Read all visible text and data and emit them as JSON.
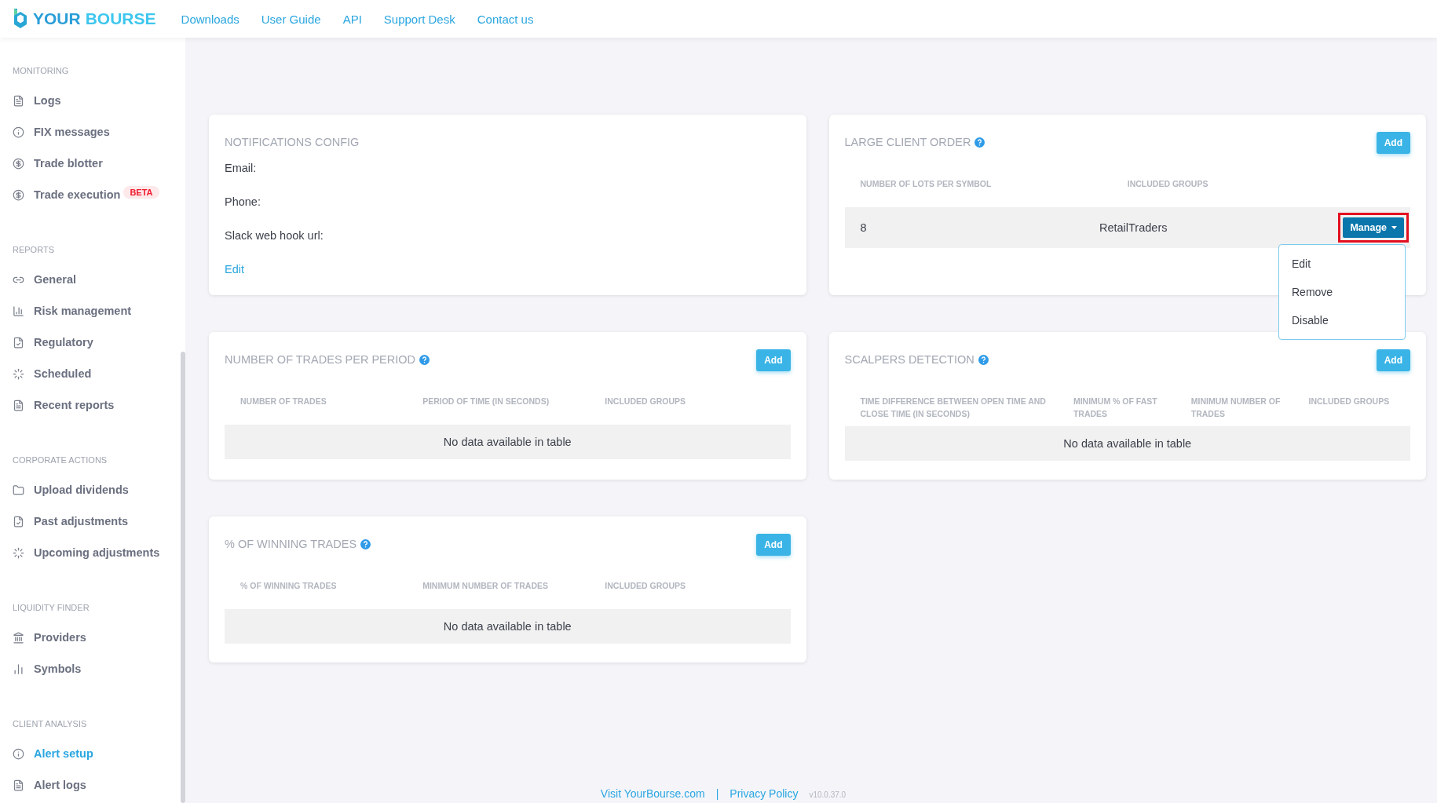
{
  "header": {
    "logo": {
      "word_1": "YOUR",
      "word_2": "BOURSE"
    },
    "nav": [
      "Downloads",
      "User Guide",
      "API",
      "Support Desk",
      "Contact us"
    ]
  },
  "sidebar": {
    "sections": [
      {
        "title": "MONITORING",
        "items": [
          {
            "label": "Logs",
            "selected": false
          },
          {
            "label": "FIX messages",
            "selected": false
          },
          {
            "label": "Trade blotter",
            "selected": false
          },
          {
            "label": "Trade execution",
            "selected": false,
            "badge": "BETA"
          }
        ]
      },
      {
        "title": "REPORTS",
        "items": [
          {
            "label": "General",
            "selected": false
          },
          {
            "label": "Risk management",
            "selected": false
          },
          {
            "label": "Regulatory",
            "selected": false
          },
          {
            "label": "Scheduled",
            "selected": false
          },
          {
            "label": "Recent reports",
            "selected": false
          }
        ]
      },
      {
        "title": "CORPORATE ACTIONS",
        "items": [
          {
            "label": "Upload dividends",
            "selected": false
          },
          {
            "label": "Past adjustments",
            "selected": false
          },
          {
            "label": "Upcoming adjustments",
            "selected": false
          }
        ]
      },
      {
        "title": "LIQUIDITY FINDER",
        "items": [
          {
            "label": "Providers",
            "selected": false
          },
          {
            "label": "Symbols",
            "selected": false
          }
        ]
      },
      {
        "title": "CLIENT ANALYSIS",
        "items": [
          {
            "label": "Alert setup",
            "selected": true
          },
          {
            "label": "Alert logs",
            "selected": false
          }
        ]
      }
    ]
  },
  "cards": [
    {
      "kind": "info",
      "title": "NOTIFICATIONS CONFIG",
      "fields": [
        "Email:",
        "Phone:",
        "Slack web hook url:"
      ],
      "link": "Edit"
    },
    {
      "kind": "table",
      "title": "LARGE CLIENT ORDER",
      "help": true,
      "add_button": "Add",
      "columns": [
        "NUMBER OF LOTS PER SYMBOL",
        "INCLUDED GROUPS"
      ],
      "rows": [
        {
          "cells": [
            "8",
            "RetailTraders"
          ],
          "action": {
            "label": "Manage",
            "highlighted": true,
            "expanded": true,
            "menu": [
              "Edit",
              "Remove",
              "Disable"
            ]
          }
        }
      ]
    },
    {
      "kind": "table",
      "title": "NUMBER OF TRADES PER PERIOD",
      "help": true,
      "add_button": "Add",
      "columns": [
        "NUMBER OF TRADES",
        "PERIOD OF TIME (IN SECONDS)",
        "INCLUDED GROUPS"
      ],
      "empty": "No data available in table"
    },
    {
      "kind": "table",
      "title": "SCALPERS DETECTION",
      "help": true,
      "add_button": "Add",
      "columns": [
        "TIME DIFFERENCE BETWEEN OPEN TIME AND CLOSE TIME (IN SECONDS)",
        "MINIMUM % OF FAST TRADES",
        "MINIMUM NUMBER OF TRADES",
        "INCLUDED GROUPS"
      ],
      "empty": "No data available in table"
    },
    {
      "kind": "table",
      "title": "% OF WINNING TRADES",
      "help": true,
      "add_button": "Add",
      "columns": [
        "% OF WINNING TRADES",
        "MINIMUM NUMBER OF TRADES",
        "INCLUDED GROUPS"
      ],
      "empty": "No data available in table"
    }
  ],
  "footer": {
    "links": [
      "Visit YourBourse.com",
      "Privacy Policy"
    ],
    "separator": "|",
    "version": "v10.0.37.0"
  }
}
